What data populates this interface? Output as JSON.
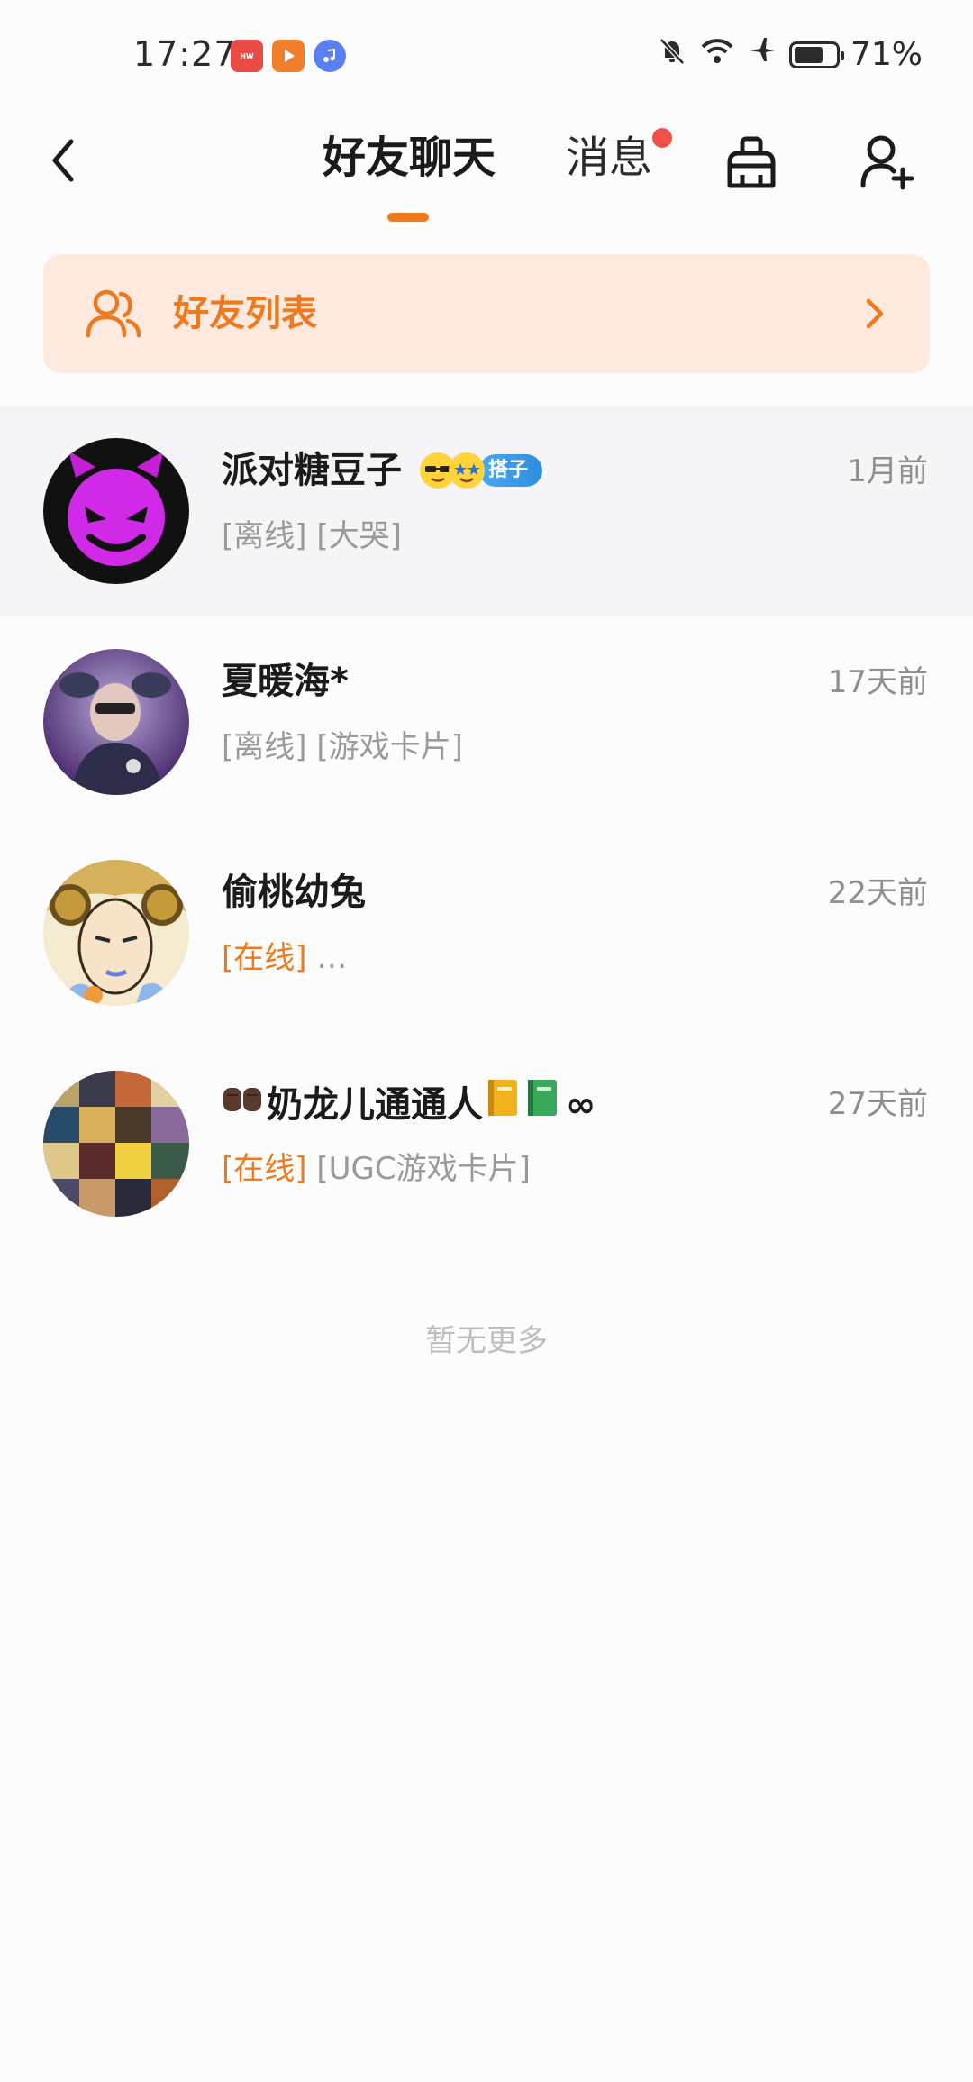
{
  "status_bar": {
    "time": "17:27",
    "battery": "71%",
    "battery_level": 0.71,
    "app_icons": [
      "huawei-store-icon",
      "video-app-icon",
      "music-app-icon"
    ],
    "indicator_icons": [
      "bell-muted-icon",
      "wifi-icon",
      "airplane-icon",
      "battery-icon"
    ]
  },
  "header": {
    "tab_friends": "好友聊天",
    "tab_messages": "消息",
    "messages_has_badge": true,
    "icons": [
      "back-icon",
      "clean-broom-icon",
      "add-friend-icon"
    ]
  },
  "banner": {
    "label": "好友列表"
  },
  "conversations": [
    {
      "name": "派对糖豆子",
      "tag": "搭子",
      "time": "1月前",
      "preview_status": "[离线]",
      "preview_text": " [大哭]",
      "online": false,
      "highlighted": true
    },
    {
      "name": "夏暖海*",
      "time": "17天前",
      "preview_status": "[离线]",
      "preview_text": " [游戏卡片]",
      "online": false,
      "highlighted": false
    },
    {
      "name": "偷桃幼兔",
      "time": "22天前",
      "preview_status": "[在线]",
      "preview_text": " …",
      "online": true,
      "highlighted": false
    },
    {
      "name": "奶龙儿通通人",
      "name_suffix": "∞",
      "time": "27天前",
      "preview_status": "[在线]",
      "preview_text": " [UGC游戏卡片]",
      "online": true,
      "highlighted": false
    }
  ],
  "footer": {
    "no_more": "暂无更多"
  },
  "colors": {
    "accent": "#ee7a1f",
    "banner_bg": "#fde9dd",
    "badge_red": "#f0504a",
    "tag_blue": "#2e8ee0"
  }
}
